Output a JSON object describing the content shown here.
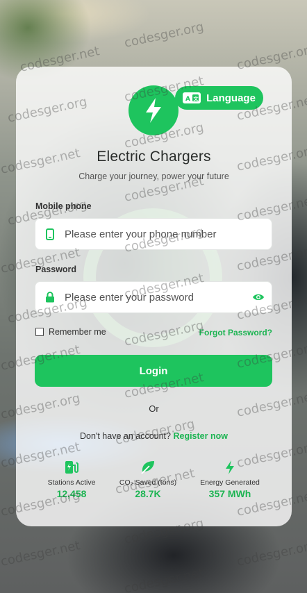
{
  "app": {
    "title": "Electric Chargers",
    "subtitle": "Charge your journey, power your future",
    "language_label": "Language"
  },
  "form": {
    "phone_label": "Mobile phone",
    "phone_placeholder": "Please enter your phone number",
    "password_label": "Password",
    "password_placeholder": "Please enter your password",
    "remember_label": "Remember me",
    "forgot_label": "Forgot Password?",
    "login_label": "Login",
    "or_label": "Or",
    "register_prompt": "Don't have an account?",
    "register_link": "Register now"
  },
  "stats": [
    {
      "icon": "charging-station-icon",
      "label": "Stations Active",
      "value": "12,458"
    },
    {
      "icon": "leaf-icon",
      "label": "CO₂ Saved (tons)",
      "value": "28.7K"
    },
    {
      "icon": "bolt-icon",
      "label": "Energy Generated",
      "value": "357 MWh"
    }
  ],
  "watermark": "codesger.org",
  "watermark_alt": "codesger.net",
  "colors": {
    "accent": "#1ec45e",
    "accent_text": "#1cb452",
    "card_bg": "rgba(255,255,255,0.80)"
  }
}
